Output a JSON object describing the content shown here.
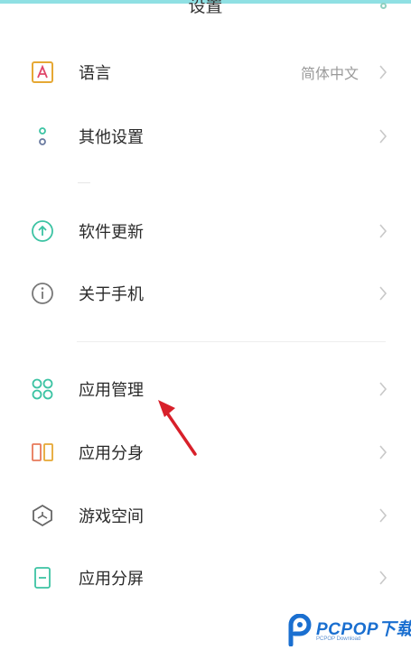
{
  "header": {
    "title": "设置"
  },
  "items": [
    {
      "label": "语言",
      "value": "简体中文",
      "icon": "language-a-icon"
    },
    {
      "label": "其他设置",
      "icon": "more-dots-icon"
    },
    {
      "label": "软件更新",
      "icon": "update-arrow-icon"
    },
    {
      "label": "关于手机",
      "icon": "info-icon"
    },
    {
      "label": "应用管理",
      "icon": "app-grid-icon"
    },
    {
      "label": "应用分身",
      "icon": "app-clone-icon"
    },
    {
      "label": "游戏空间",
      "icon": "game-space-icon"
    },
    {
      "label": "应用分屏",
      "icon": "split-screen-icon"
    }
  ],
  "watermark": {
    "brand": "PCPOP下载",
    "sub": "PCPOP Download"
  },
  "colors": {
    "topbar": "#8fe0e3",
    "accent_teal": "#3cc3a3",
    "language_icon": "#e6a834",
    "clone_icon": "#e8795a",
    "arrow": "#d8202a",
    "watermark": "#1a6fd0"
  }
}
